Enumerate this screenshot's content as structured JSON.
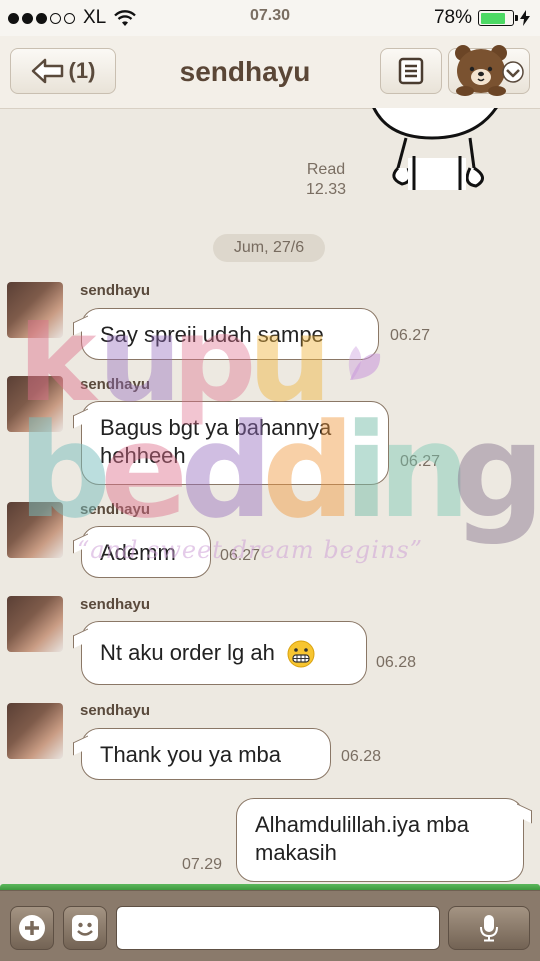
{
  "status": {
    "carrier": "XL",
    "time": "07.30",
    "battery": "78%",
    "battery_level": 0.78
  },
  "header": {
    "back_label": "(1)",
    "title": "sendhayu"
  },
  "chat": {
    "read_status": "Read",
    "read_time": "12.33",
    "date": "Jum, 27/6",
    "messages": [
      {
        "sender": "sendhayu",
        "text": "Say spreii udah sampe",
        "time": "06.27"
      },
      {
        "sender": "sendhayu",
        "text_line1": "Bagus bgt ya bahannya",
        "text_line2": "hehheeh",
        "time": "06.27"
      },
      {
        "sender": "sendhayu",
        "text": "Ademm",
        "time": "06.27"
      },
      {
        "sender": "sendhayu",
        "text": "Nt aku order lg ah",
        "emoji": "grimacing-face",
        "time": "06.28"
      },
      {
        "sender": "sendhayu",
        "text": "Thank you ya mba",
        "time": "06.28"
      }
    ],
    "outgoing": {
      "text_line1": "Alhamdulillah.iya mba",
      "text_line2": "makasih",
      "time": "07.29"
    }
  },
  "watermark": {
    "brand_line1": "kupu",
    "brand_line2": "bedding",
    "tagline": "“and sweet dream begins”"
  },
  "composer": {
    "input_value": "",
    "icons": [
      "plus-icon",
      "sticker-icon",
      "mic-icon"
    ]
  },
  "colors": {
    "background": "#ede9e1",
    "header": "#f3efe8",
    "title": "#5a4636",
    "bubble_border": "#8a7766",
    "bottom_bar": "#8a7a6b",
    "battery_green": "#4cd964"
  }
}
